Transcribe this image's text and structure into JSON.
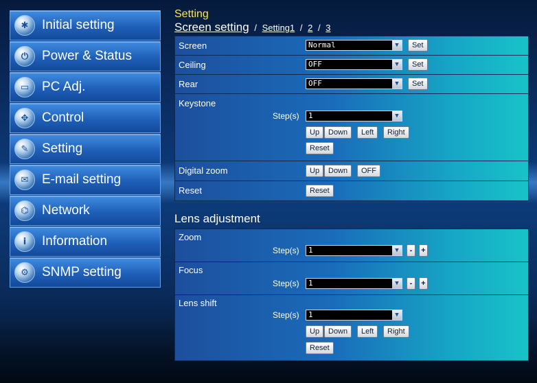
{
  "sidebar": {
    "items": [
      {
        "label": "Initial setting"
      },
      {
        "label": "Power & Status"
      },
      {
        "label": "PC Adj."
      },
      {
        "label": "Control"
      },
      {
        "label": "Setting"
      },
      {
        "label": "E-mail setting"
      },
      {
        "label": "Network"
      },
      {
        "label": "Information"
      },
      {
        "label": "SNMP setting"
      }
    ]
  },
  "header": {
    "title": "Setting",
    "breadcrumb": {
      "current": "Screen setting",
      "sep": "/",
      "link1": "Setting1",
      "link2": "2",
      "link3": "3"
    }
  },
  "screen_setting": {
    "screen": {
      "label": "Screen",
      "value": "Normal",
      "set": "Set"
    },
    "ceiling": {
      "label": "Ceiling",
      "value": "OFF",
      "set": "Set"
    },
    "rear": {
      "label": "Rear",
      "value": "OFF",
      "set": "Set"
    },
    "keystone": {
      "label": "Keystone",
      "steps_label": "Step(s)",
      "steps_value": "1",
      "up": "Up",
      "down": "Down",
      "left": "Left",
      "right": "Right",
      "reset": "Reset"
    },
    "digital_zoom": {
      "label": "Digital zoom",
      "up": "Up",
      "down": "Down",
      "off": "OFF"
    },
    "reset": {
      "label": "Reset",
      "button": "Reset"
    }
  },
  "lens": {
    "title": "Lens adjustment",
    "zoom": {
      "label": "Zoom",
      "steps_label": "Step(s)",
      "steps_value": "1",
      "minus": "-",
      "plus": "+"
    },
    "focus": {
      "label": "Focus",
      "steps_label": "Step(s)",
      "steps_value": "1",
      "minus": "-",
      "plus": "+"
    },
    "shift": {
      "label": "Lens shift",
      "steps_label": "Step(s)",
      "steps_value": "1",
      "up": "Up",
      "down": "Down",
      "left": "Left",
      "right": "Right",
      "reset": "Reset"
    }
  },
  "icons": {
    "dropdown": "chevron-down-icon"
  },
  "colors": {
    "title": "#ffe44a",
    "nav_bg": "#1f5fb8",
    "row_start": "#1c4f9d",
    "row_end": "#18c2c8"
  }
}
